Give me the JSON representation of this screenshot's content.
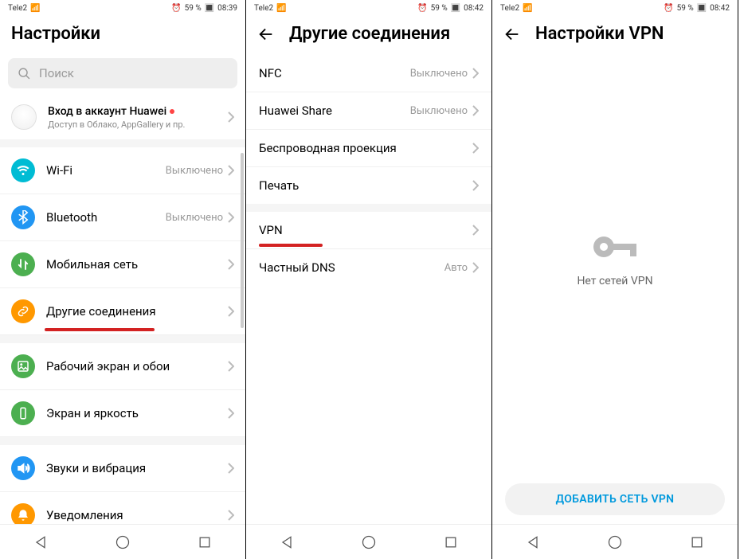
{
  "status": {
    "carrier": "Tele2",
    "signal": "4G",
    "battery_icon": "59 %",
    "time1": "08:39",
    "time2": "08:42",
    "time3": "08:42",
    "alarm": "⏰"
  },
  "screen1": {
    "title": "Настройки",
    "search_placeholder": "Поиск",
    "account": {
      "title": "Вход в аккаунт Huawei",
      "sub": "Доступ в Облако, AppGallery и пр."
    },
    "rows": {
      "wifi": {
        "label": "Wi-Fi",
        "value": "Выключено"
      },
      "bt": {
        "label": "Bluetooth",
        "value": "Выключено"
      },
      "mobile": {
        "label": "Мобильная сеть"
      },
      "other": {
        "label": "Другие соединения"
      },
      "home": {
        "label": "Рабочий экран и обои"
      },
      "screen": {
        "label": "Экран и яркость"
      },
      "sound": {
        "label": "Звуки и вибрация"
      },
      "notif": {
        "label": "Уведомления"
      }
    }
  },
  "screen2": {
    "title": "Другие соединения",
    "rows": {
      "nfc": {
        "label": "NFC",
        "value": "Выключено"
      },
      "share": {
        "label": "Huawei Share",
        "value": "Выключено"
      },
      "proj": {
        "label": "Беспроводная проекция"
      },
      "print": {
        "label": "Печать"
      },
      "vpn": {
        "label": "VPN"
      },
      "dns": {
        "label": "Частный DNS",
        "value": "Авто"
      }
    }
  },
  "screen3": {
    "title": "Настройки VPN",
    "empty": "Нет сетей VPN",
    "add": "ДОБАВИТЬ СЕТЬ VPN"
  }
}
